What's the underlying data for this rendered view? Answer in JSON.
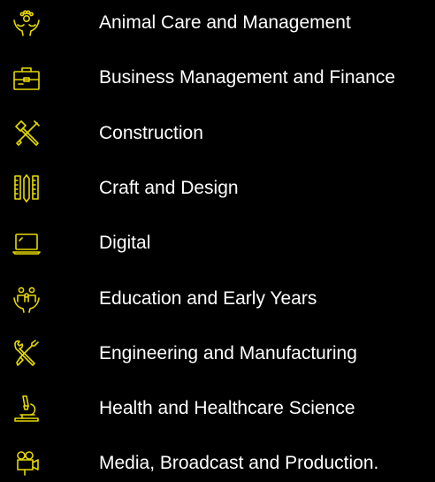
{
  "accent_color": "#e6d900",
  "text_color": "#ffffff",
  "background_color": "#000000",
  "items": [
    {
      "label": "Animal Care and Management",
      "icon": "animal-care-icon"
    },
    {
      "label": "Business Management and Finance",
      "icon": "briefcase-icon"
    },
    {
      "label": "Construction",
      "icon": "hammer-tools-icon"
    },
    {
      "label": "Craft and Design",
      "icon": "ruler-pencil-icon"
    },
    {
      "label": "Digital",
      "icon": "laptop-icon"
    },
    {
      "label": "Education and Early Years",
      "icon": "family-hands-icon"
    },
    {
      "label": "Engineering and Manufacturing",
      "icon": "wrench-screwdriver-icon"
    },
    {
      "label": "Health and Healthcare Science",
      "icon": "microscope-icon"
    },
    {
      "label": "Media, Broadcast and Production.",
      "icon": "film-camera-icon"
    }
  ]
}
